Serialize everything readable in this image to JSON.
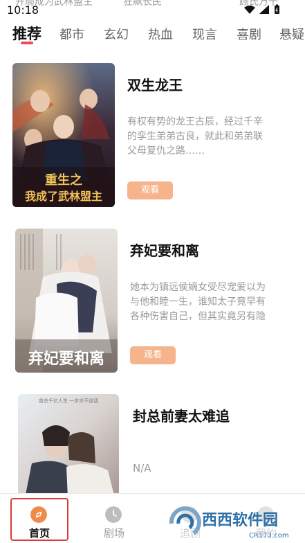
{
  "status_bar": {
    "time": "10:18",
    "ghost_left": "开局成为武林盟主",
    "ghost_mid": "狂飙长民",
    "ghost_right": "顾氏万千"
  },
  "tabs": [
    {
      "label": "推荐",
      "active": true
    },
    {
      "label": "都市",
      "active": false
    },
    {
      "label": "玄幻",
      "active": false
    },
    {
      "label": "热血",
      "active": false
    },
    {
      "label": "现言",
      "active": false
    },
    {
      "label": "喜剧",
      "active": false
    },
    {
      "label": "悬疑",
      "active": false
    }
  ],
  "colors": {
    "accent": "#ee4a5b",
    "button": "#f6b48c",
    "highlight_box": "#d93b3b",
    "home_icon": "#f08a4b"
  },
  "dramas": [
    {
      "title": "双生龙王",
      "description_lines": [
        "有权有势的龙王古辰，经过千辛",
        "的孪生弟弟古良，就此和弟弟联",
        "父母复仇之路……"
      ],
      "button": "观看",
      "poster_text": "重生之我成了武林盟主"
    },
    {
      "title": "弃妃要和离",
      "description_lines": [
        "她本为镇远侯嫡女受尽宠爱以为",
        "与他和睦一生，谁知太子竟早有",
        "各种伤害自己，但其实竟另有隐"
      ],
      "button": "观看",
      "poster_text": "弃妃要和离"
    },
    {
      "title": "封总前妻太难追",
      "description_lines": [
        "N/A"
      ],
      "button": "",
      "poster_text": "曾总千亿人生 一步步不说话"
    }
  ],
  "bottom_nav": [
    {
      "label": "首页",
      "icon": "compass-icon",
      "active": true
    },
    {
      "label": "剧场",
      "icon": "clock-icon",
      "active": false
    },
    {
      "label": "追剧",
      "icon": "heart-icon",
      "active": false
    },
    {
      "label": "我的",
      "icon": "user-icon",
      "active": false
    }
  ],
  "watermark": {
    "text": "西西软件园",
    "url": "CR173.com"
  }
}
